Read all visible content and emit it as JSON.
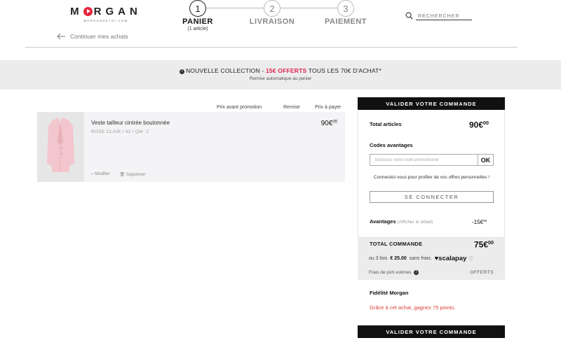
{
  "header": {
    "logo": "MORGAN",
    "logo_sub": "MORGANDETOI.COM",
    "steps": [
      {
        "number": "1",
        "label": "PANIER",
        "sub": "(1 article)"
      },
      {
        "number": "2",
        "label": "LIVRAISON"
      },
      {
        "number": "3",
        "label": "PAIEMENT"
      }
    ],
    "search_placeholder": "RECHERCHER",
    "continue_label": "Continuer mes achats"
  },
  "banner": {
    "part1": "NOUVELLE COLLECTION - ",
    "highlight": "15€ OFFERTS",
    "part2": " TOUS LES 70€ D'ACHAT*",
    "sub": "Remise automatique au panier",
    "info_glyph": "i"
  },
  "cart": {
    "columns": {
      "price_before": "Prix avant promotion",
      "discount": "Remise",
      "to_pay": "Prix à payer"
    },
    "items": [
      {
        "name": "Veste tailleur cintrée boutonnée",
        "variant": "ROSE CLAIR / 42 / Qté :1",
        "price": "90€",
        "price_cents": "00",
        "modify": "Modifier",
        "delete": "Supprimer"
      }
    ]
  },
  "summary": {
    "validate_label": "VALIDER VOTRE COMMANDE",
    "total_articles_label": "Total articles",
    "total_articles_price": "90€",
    "total_articles_cents": "00",
    "codes_label": "Codes avantages",
    "code_placeholder": "Saisissez votre code promotionnel",
    "ok_label": "OK",
    "login_text": "Connectez-vous pour profiter de vos offres personnelles !",
    "connect_label": "SE CONNECTER",
    "advantages_label": "Avantages",
    "advantages_note": "(Afficher le détail)",
    "advantages_value": "-15€",
    "advantages_cents": "00",
    "total_label": "TOTAL COMMANDE",
    "total_price": "75€",
    "total_cents": "00",
    "scalapay_prefix": "ou 3 fois",
    "scalapay_amount": "€ 25.00",
    "scalapay_suffix": "sans frais.",
    "scalapay_brand": "scalapay",
    "shipping_label": "Frais de port estimés",
    "shipping_value": "OFFERTS",
    "fidelity_title": "Fidélité Morgan",
    "fidelity_text": "Grâce à cet achat, gagnez 75 points."
  },
  "colors": {
    "accent": "#e0244a",
    "dark": "#111111",
    "points": "#d9403a"
  }
}
